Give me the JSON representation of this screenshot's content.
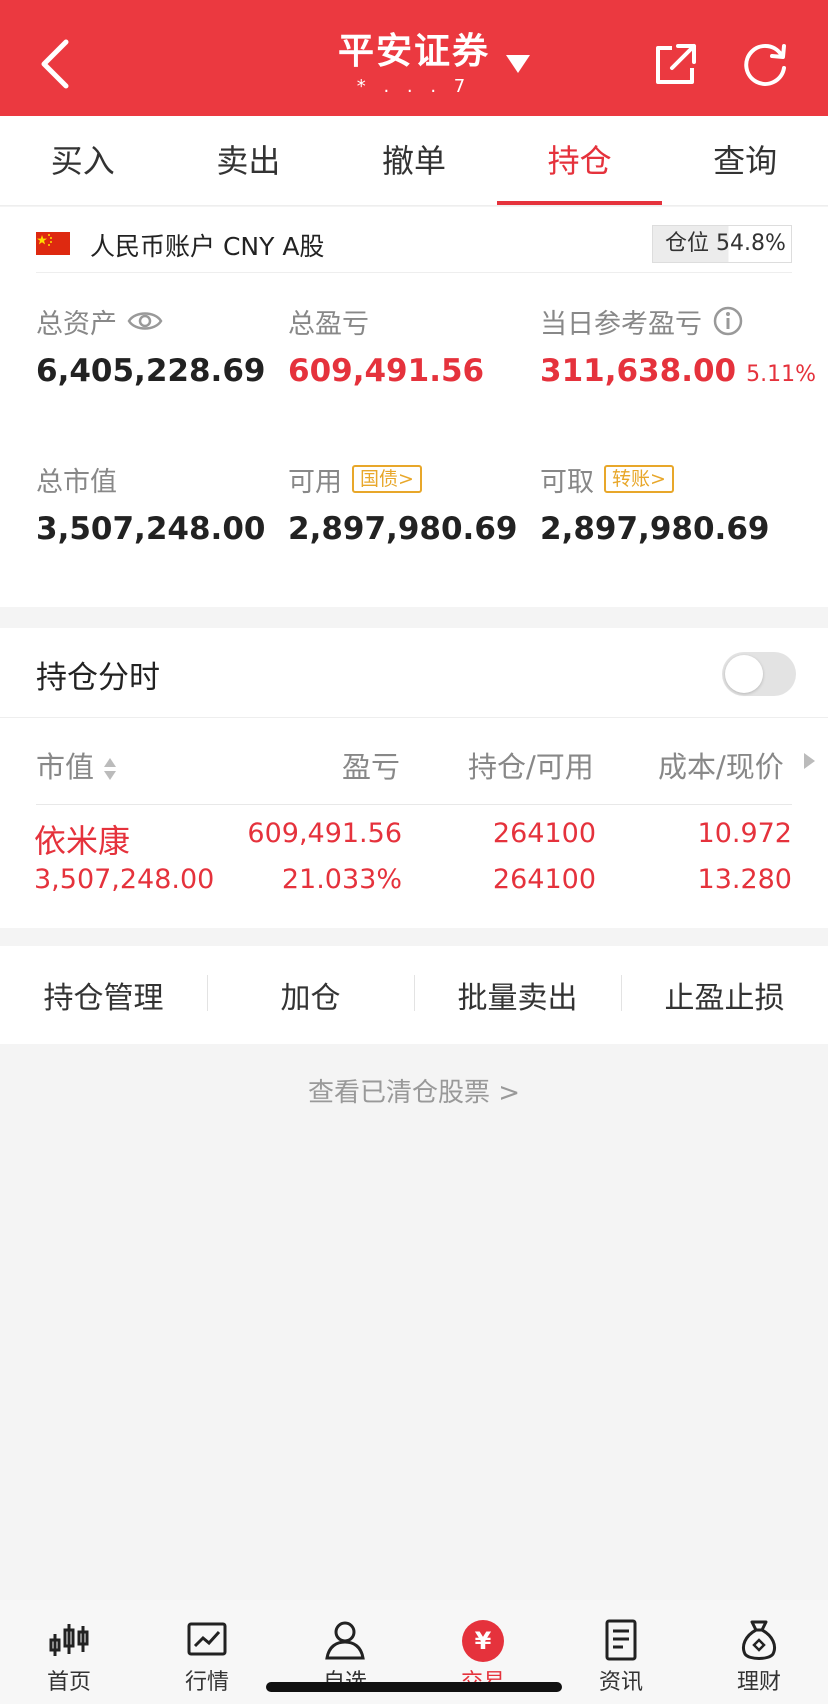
{
  "header": {
    "title": "平安证券",
    "subtitle": "* . . . 7"
  },
  "tabs": [
    {
      "label": "买入"
    },
    {
      "label": "卖出"
    },
    {
      "label": "撤单"
    },
    {
      "label": "持仓"
    },
    {
      "label": "查询"
    }
  ],
  "account": {
    "name": "人民币账户 CNY A股",
    "position_label": "仓位 54.8%",
    "position_ratio": 0.548
  },
  "metrics": {
    "total_assets": {
      "label": "总资产",
      "value": "6,405,228.69"
    },
    "total_pnl": {
      "label": "总盈亏",
      "value": "609,491.56"
    },
    "daily_pnl": {
      "label": "当日参考盈亏",
      "value": "311,638.00",
      "pct": "5.11%"
    },
    "market_value": {
      "label": "总市值",
      "value": "3,507,248.00"
    },
    "available": {
      "label": "可用",
      "badge": "国债>",
      "value": "2,897,980.69"
    },
    "withdrawable": {
      "label": "可取",
      "badge": "转账>",
      "value": "2,897,980.69"
    }
  },
  "holdings": {
    "timeshare_label": "持仓分时",
    "timeshare_on": false,
    "columns": {
      "market_value": "市值",
      "pnl": "盈亏",
      "qty": "持仓/可用",
      "cost": "成本/现价"
    },
    "rows": [
      {
        "name": "依米康",
        "market_value": "3,507,248.00",
        "pnl": "609,491.56",
        "pnl_pct": "21.033%",
        "position": "264100",
        "available": "264100",
        "cost": "10.972",
        "price": "13.280"
      }
    ]
  },
  "actions": [
    {
      "label": "持仓管理"
    },
    {
      "label": "加仓"
    },
    {
      "label": "批量卖出"
    },
    {
      "label": "止盈止损"
    }
  ],
  "cleared_link": "查看已清仓股票  >",
  "bottom_nav": [
    {
      "label": "首页",
      "icon": "candlestick-icon"
    },
    {
      "label": "行情",
      "icon": "chart-icon"
    },
    {
      "label": "自选",
      "icon": "user-star-icon"
    },
    {
      "label": "交易",
      "icon": "yen-icon"
    },
    {
      "label": "资讯",
      "icon": "document-icon"
    },
    {
      "label": "理财",
      "icon": "money-bag-icon"
    }
  ],
  "colors": {
    "brand_red": "#eb3940",
    "gain_red": "#e5323c",
    "badge_orange": "#e8a72a"
  }
}
